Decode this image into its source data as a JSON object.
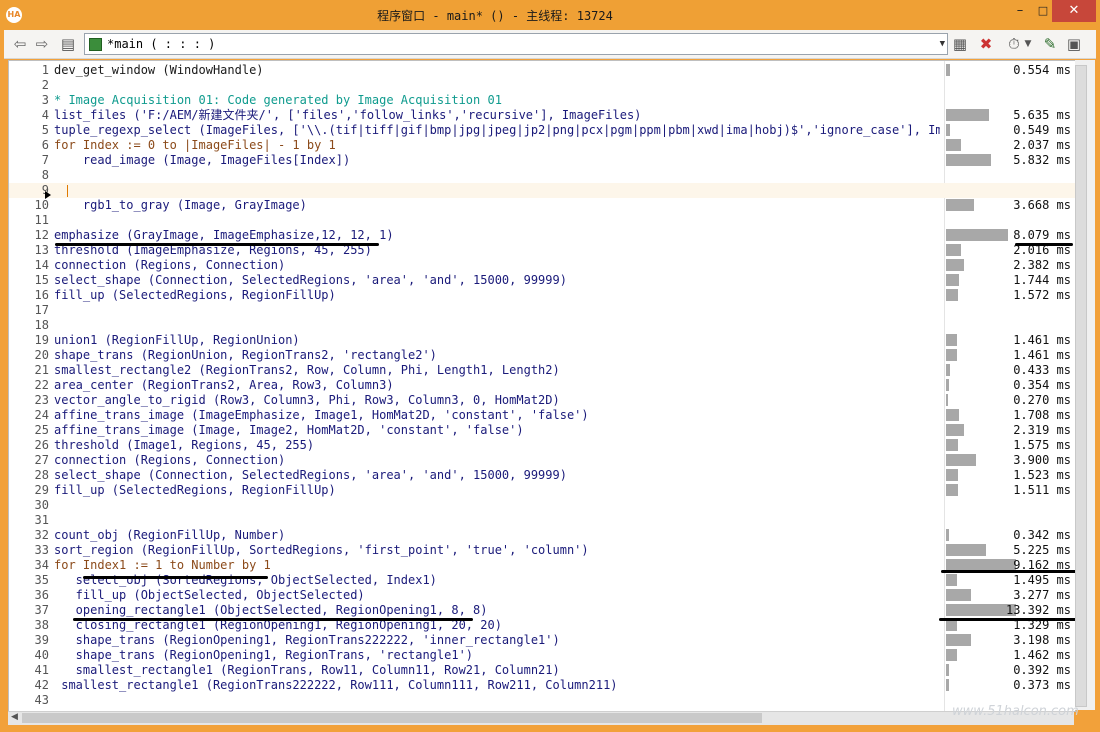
{
  "window": {
    "title": "程序窗口 - main* () - 主线程: 13724",
    "icon": "halcon-app-icon"
  },
  "toolbar": {
    "procedure": "*main ( : : : )"
  },
  "watermark": "www.51halcon.com",
  "lines": [
    {
      "n": "1",
      "code": "dev_get_window (WindowHandle)",
      "type": "dark",
      "time": "0.554 ms",
      "bar": 0.05
    },
    {
      "n": "2",
      "code": "",
      "type": "",
      "time": "",
      "bar": 0
    },
    {
      "n": "3",
      "code": "* Image Acquisition 01: Code generated by Image Acquisition 01",
      "type": "cm",
      "time": "",
      "bar": 0
    },
    {
      "n": "4",
      "code": "list_files ('F:/AEM/新建文件夹/', ['files','follow_links','recursive'], ImageFiles)",
      "type": "",
      "time": "5.635 ms",
      "bar": 0.62
    },
    {
      "n": "5",
      "code": "tuple_regexp_select (ImageFiles, ['\\\\.(tif|tiff|gif|bmp|jpg|jpeg|jp2|png|pcx|pgm|ppm|pbm|xwd|ima|hobj)$','ignore_case'], ImageF",
      "type": "",
      "time": "0.549 ms",
      "bar": 0.06
    },
    {
      "n": "6",
      "code": "for Index := 0 to |ImageFiles| - 1 by 1",
      "type": "kw",
      "time": "2.037 ms",
      "bar": 0.22
    },
    {
      "n": "7",
      "code": "    read_image (Image, ImageFiles[Index])",
      "type": "",
      "time": "5.832 ms",
      "bar": 0.64
    },
    {
      "n": "8",
      "code": "",
      "type": "",
      "time": "",
      "bar": 0
    },
    {
      "n": "9",
      "code": "",
      "type": "",
      "time": "",
      "bar": 0,
      "highlight": true
    },
    {
      "n": "10",
      "code": "    rgb1_to_gray (Image, GrayImage)",
      "type": "",
      "time": "3.668 ms",
      "bar": 0.4
    },
    {
      "n": "11",
      "code": "",
      "type": "",
      "time": "",
      "bar": 0
    },
    {
      "n": "12",
      "code": "emphasize (GrayImage, ImageEmphasize,12, 12, 1)",
      "type": "",
      "time": "8.079 ms",
      "bar": 0.89
    },
    {
      "n": "13",
      "code": "threshold (ImageEmphasize, Regions, 45, 255)",
      "type": "",
      "time": "2.016 ms",
      "bar": 0.22
    },
    {
      "n": "14",
      "code": "connection (Regions, Connection)",
      "type": "",
      "time": "2.382 ms",
      "bar": 0.26
    },
    {
      "n": "15",
      "code": "select_shape (Connection, SelectedRegions, 'area', 'and', 15000, 99999)",
      "type": "",
      "time": "1.744 ms",
      "bar": 0.19
    },
    {
      "n": "16",
      "code": "fill_up (SelectedRegions, RegionFillUp)",
      "type": "",
      "time": "1.572 ms",
      "bar": 0.17
    },
    {
      "n": "17",
      "code": "",
      "type": "",
      "time": "",
      "bar": 0
    },
    {
      "n": "18",
      "code": "",
      "type": "",
      "time": "",
      "bar": 0
    },
    {
      "n": "19",
      "code": "union1 (RegionFillUp, RegionUnion)",
      "type": "",
      "time": "1.461 ms",
      "bar": 0.16
    },
    {
      "n": "20",
      "code": "shape_trans (RegionUnion, RegionTrans2, 'rectangle2')",
      "type": "",
      "time": "1.461 ms",
      "bar": 0.16
    },
    {
      "n": "21",
      "code": "smallest_rectangle2 (RegionTrans2, Row, Column, Phi, Length1, Length2)",
      "type": "",
      "time": "0.433 ms",
      "bar": 0.05
    },
    {
      "n": "22",
      "code": "area_center (RegionTrans2, Area, Row3, Column3)",
      "type": "",
      "time": "0.354 ms",
      "bar": 0.04
    },
    {
      "n": "23",
      "code": "vector_angle_to_rigid (Row3, Column3, Phi, Row3, Column3, 0, HomMat2D)",
      "type": "",
      "time": "0.270 ms",
      "bar": 0.03
    },
    {
      "n": "24",
      "code": "affine_trans_image (ImageEmphasize, Image1, HomMat2D, 'constant', 'false')",
      "type": "",
      "time": "1.708 ms",
      "bar": 0.19
    },
    {
      "n": "25",
      "code": "affine_trans_image (Image, Image2, HomMat2D, 'constant', 'false')",
      "type": "",
      "time": "2.319 ms",
      "bar": 0.25
    },
    {
      "n": "26",
      "code": "threshold (Image1, Regions, 45, 255)",
      "type": "",
      "time": "1.575 ms",
      "bar": 0.17
    },
    {
      "n": "27",
      "code": "connection (Regions, Connection)",
      "type": "",
      "time": "3.900 ms",
      "bar": 0.43
    },
    {
      "n": "28",
      "code": "select_shape (Connection, SelectedRegions, 'area', 'and', 15000, 99999)",
      "type": "",
      "time": "1.523 ms",
      "bar": 0.17
    },
    {
      "n": "29",
      "code": "fill_up (SelectedRegions, RegionFillUp)",
      "type": "",
      "time": "1.511 ms",
      "bar": 0.17
    },
    {
      "n": "30",
      "code": "",
      "type": "",
      "time": "",
      "bar": 0
    },
    {
      "n": "31",
      "code": "",
      "type": "",
      "time": "",
      "bar": 0
    },
    {
      "n": "32",
      "code": "count_obj (RegionFillUp, Number)",
      "type": "",
      "time": "0.342 ms",
      "bar": 0.04
    },
    {
      "n": "33",
      "code": "sort_region (RegionFillUp, SortedRegions, 'first_point', 'true', 'column')",
      "type": "",
      "time": "5.225 ms",
      "bar": 0.57
    },
    {
      "n": "34",
      "code": "for Index1 := 1 to Number by 1",
      "type": "kw",
      "time": "9.162 ms",
      "bar": 1.0
    },
    {
      "n": "35",
      "code": "   select_obj (SortedRegions, ObjectSelected, Index1)",
      "type": "",
      "time": "1.495 ms",
      "bar": 0.16
    },
    {
      "n": "36",
      "code": "   fill_up (ObjectSelected, ObjectSelected)",
      "type": "",
      "time": "3.277 ms",
      "bar": 0.36
    },
    {
      "n": "37",
      "code": "   opening_rectangle1 (ObjectSelected, RegionOpening1, 8, 8)",
      "type": "",
      "time": "13.392 ms",
      "bar": 1.0
    },
    {
      "n": "38",
      "code": "   closing_rectangle1 (RegionOpening1, RegionOpening1, 20, 20)",
      "type": "",
      "time": "1.329 ms",
      "bar": 0.15
    },
    {
      "n": "39",
      "code": "   shape_trans (RegionOpening1, RegionTrans222222, 'inner_rectangle1')",
      "type": "",
      "time": "3.198 ms",
      "bar": 0.35
    },
    {
      "n": "40",
      "code": "   shape_trans (RegionOpening1, RegionTrans, 'rectangle1')",
      "type": "",
      "time": "1.462 ms",
      "bar": 0.16
    },
    {
      "n": "41",
      "code": "   smallest_rectangle1 (RegionTrans, Row11, Column11, Row21, Column21)",
      "type": "",
      "time": "0.392 ms",
      "bar": 0.04
    },
    {
      "n": "42",
      "code": " smallest_rectangle1 (RegionTrans222222, Row111, Column111, Row211, Column211)",
      "type": "",
      "time": "0.373 ms",
      "bar": 0.04
    },
    {
      "n": "43",
      "code": "",
      "type": "",
      "time": "",
      "bar": 0
    }
  ]
}
